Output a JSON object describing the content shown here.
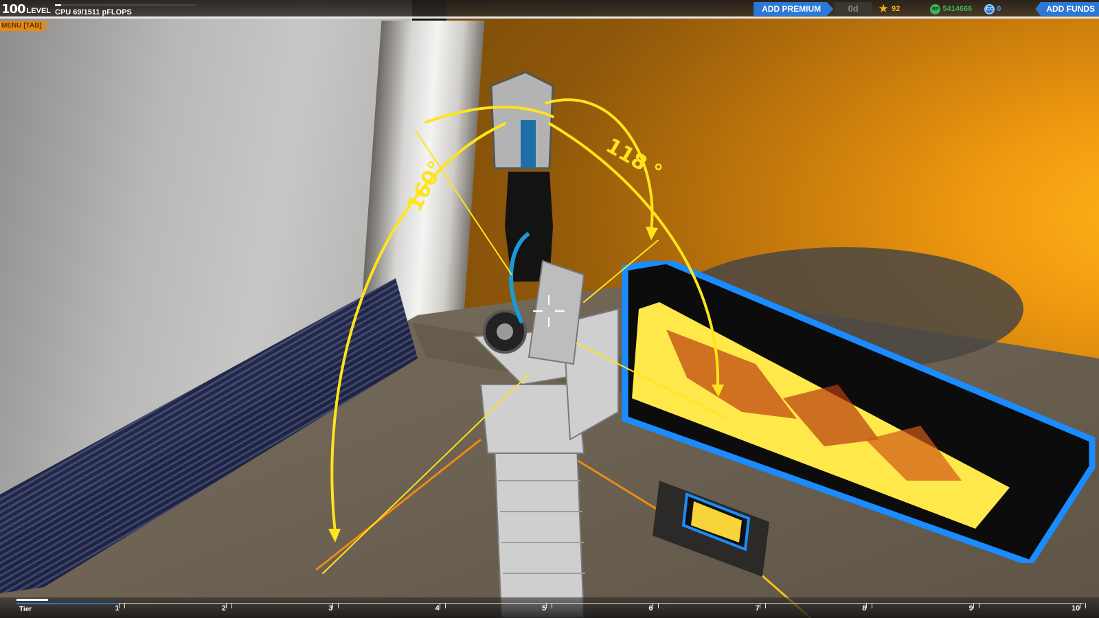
{
  "hud": {
    "level_value": "100",
    "level_label": "LEVEL",
    "cpu_text": "CPU 69/1511 pFLOPS",
    "cpu_fraction": 0.046,
    "menu_label": "MENU [TAB]",
    "premium_button": "ADD PREMIUM",
    "premium_days": "0d",
    "stars": "92",
    "robits": "5414666",
    "cosmetic_credits": "0",
    "funds_button": "ADD FUNDS",
    "icons": {
      "stars": "star-icon",
      "robits": "rp-icon",
      "credits": "cc-icon"
    },
    "rp_icon_text": "RP",
    "cc_icon_text": "CC",
    "accent_color": "#2b78d6"
  },
  "scene": {
    "angle_left": "160°",
    "angle_right": "118 °",
    "arc_color": "#ffe41a"
  },
  "tier": {
    "label": "Tier",
    "ticks": [
      "1",
      "2",
      "3",
      "4",
      "5",
      "6",
      "7",
      "8",
      "9",
      "10"
    ],
    "progress_fraction": 0.03
  }
}
